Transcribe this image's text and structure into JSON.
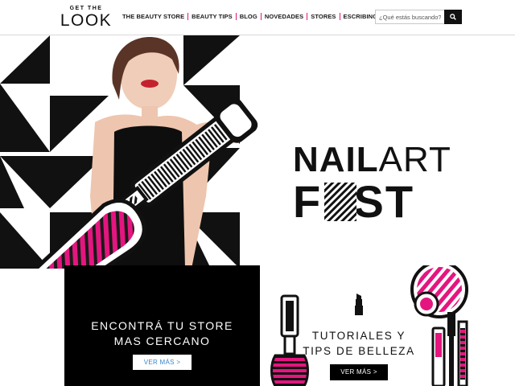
{
  "brand": {
    "top": "GET THE",
    "main": "LOOK"
  },
  "nav": {
    "items": [
      {
        "label": "THE BEAUTY STORE"
      },
      {
        "label": "BEAUTY TIPS"
      },
      {
        "label": "BLOG"
      },
      {
        "label": "NOVEDADES"
      },
      {
        "label": "STORES"
      },
      {
        "label": "ESCRIBINOS"
      }
    ]
  },
  "search": {
    "placeholder": "¿Qué estás buscando?",
    "icon": "search-icon"
  },
  "hero": {
    "title_line1_a": "NAIL",
    "title_line1_b": "ART",
    "title_line2": "FEST",
    "accent_color": "#e5157f"
  },
  "store_promo": {
    "title_line1": "ENCONTRÁ TU STORE",
    "title_line2": "MAS CERCANO",
    "button": "VER MÁS >"
  },
  "tutorials_promo": {
    "title_line1": "TUTORIALES Y",
    "title_line2": "TIPS DE BELLEZA",
    "button": "VER MÁS >"
  }
}
